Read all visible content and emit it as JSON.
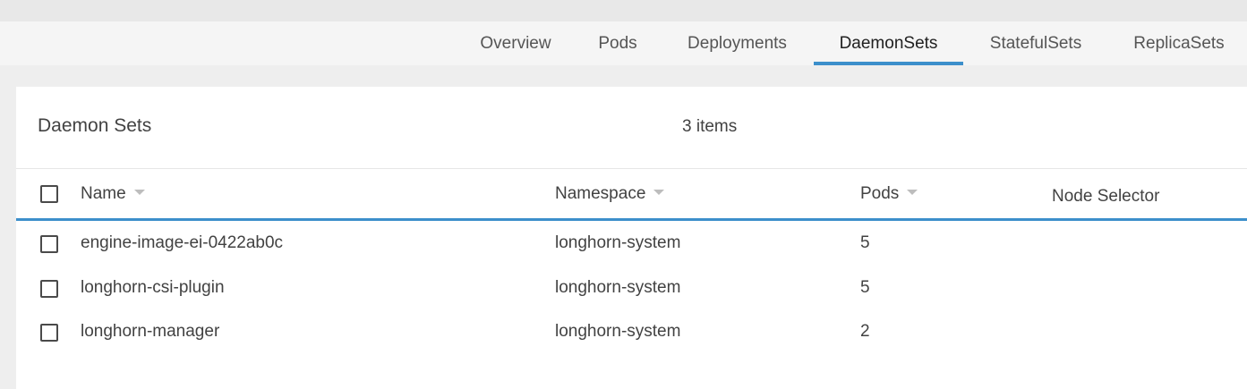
{
  "colors": {
    "accent": "#3c8fcb"
  },
  "tabs": [
    {
      "label": "Overview",
      "active": false
    },
    {
      "label": "Pods",
      "active": false
    },
    {
      "label": "Deployments",
      "active": false
    },
    {
      "label": "DaemonSets",
      "active": true
    },
    {
      "label": "StatefulSets",
      "active": false
    },
    {
      "label": "ReplicaSets",
      "active": false
    }
  ],
  "card": {
    "title": "Daemon Sets",
    "count": "3 items"
  },
  "table": {
    "columns": {
      "name": "Name",
      "namespace": "Namespace",
      "pods": "Pods",
      "node_selector": "Node Selector"
    },
    "rows": [
      {
        "name": "engine-image-ei-0422ab0c",
        "namespace": "longhorn-system",
        "pods": "5",
        "node_selector": ""
      },
      {
        "name": "longhorn-csi-plugin",
        "namespace": "longhorn-system",
        "pods": "5",
        "node_selector": ""
      },
      {
        "name": "longhorn-manager",
        "namespace": "longhorn-system",
        "pods": "2",
        "node_selector": ""
      }
    ]
  }
}
